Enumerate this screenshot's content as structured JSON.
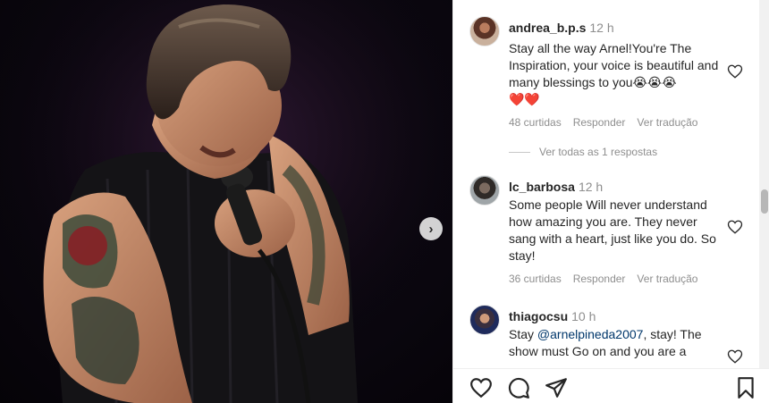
{
  "post": {
    "next_arrow": "›"
  },
  "comments": [
    {
      "username": "andrea_b.p.s",
      "time": "12 h",
      "text": "Stay all the way Arnel!You're The Inspiration, your voice is beautiful and many blessings to you😭😭😭",
      "emoji_line": "❤️❤️",
      "likes": "48 curtidas",
      "reply_label": "Responder",
      "translate_label": "Ver tradução",
      "view_replies": "Ver todas as 1 respostas"
    },
    {
      "username": "lc_barbosa",
      "time": "12 h",
      "text": "Some people Will never understand how amazing you are. They never sang with a heart, just like you do. So stay!",
      "likes": "36 curtidas",
      "reply_label": "Responder",
      "translate_label": "Ver tradução"
    },
    {
      "username": "thiagocsu",
      "time": "10 h",
      "text_prefix": "Stay ",
      "mention": "@arnelpineda2007",
      "text_suffix": ", stay! The show must Go on and you are a"
    }
  ],
  "icons": {
    "like": "heart-icon",
    "comment": "comment-icon",
    "share": "send-icon",
    "save": "bookmark-icon"
  },
  "colors": {
    "text": "#262626",
    "secondary": "#8e8e8e",
    "mention": "#00376b"
  }
}
